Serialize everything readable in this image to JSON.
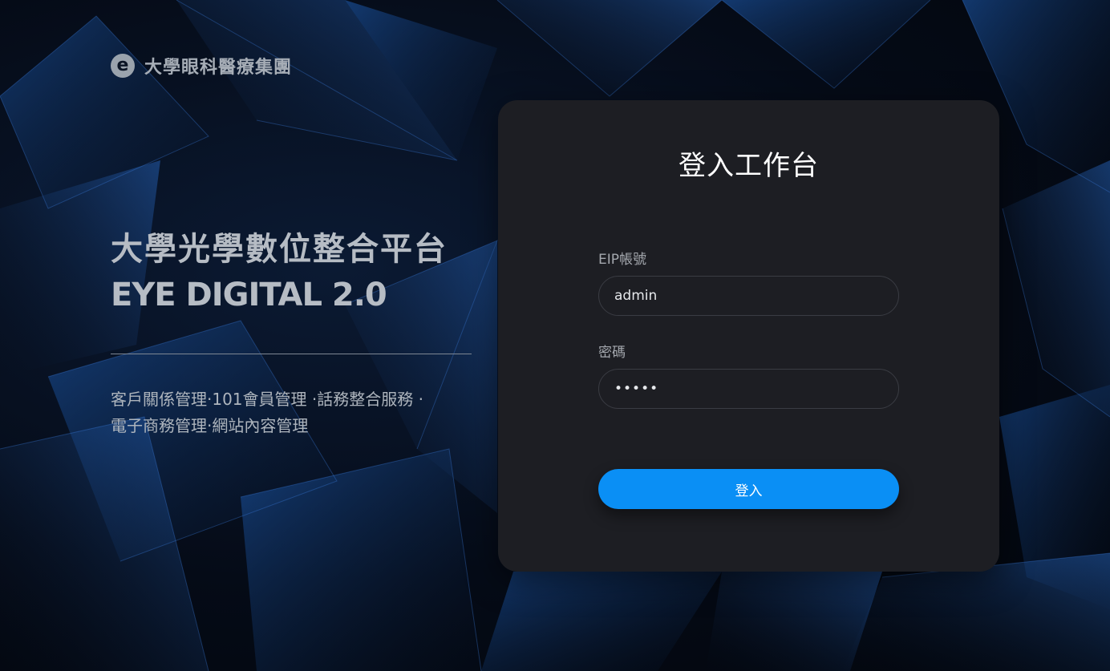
{
  "brand": {
    "logo_glyph": "e",
    "name": "大學眼科醫療集團"
  },
  "hero": {
    "title": "大學光學數位整合平台",
    "subtitle": "EYE DIGITAL 2.0",
    "desc_line1": "客戶關係管理‧101會員管理 ‧話務整合服務 ‧",
    "desc_line2": "電子商務管理‧網站內容管理"
  },
  "login": {
    "title": "登入工作台",
    "account_label": "EIP帳號",
    "account_value": "admin",
    "password_label": "密碼",
    "password_value": "•••••",
    "submit_label": "登入"
  },
  "colors": {
    "accent": "#0a8ff5",
    "card_background": "#1d1e23",
    "page_background": "#050b17"
  }
}
